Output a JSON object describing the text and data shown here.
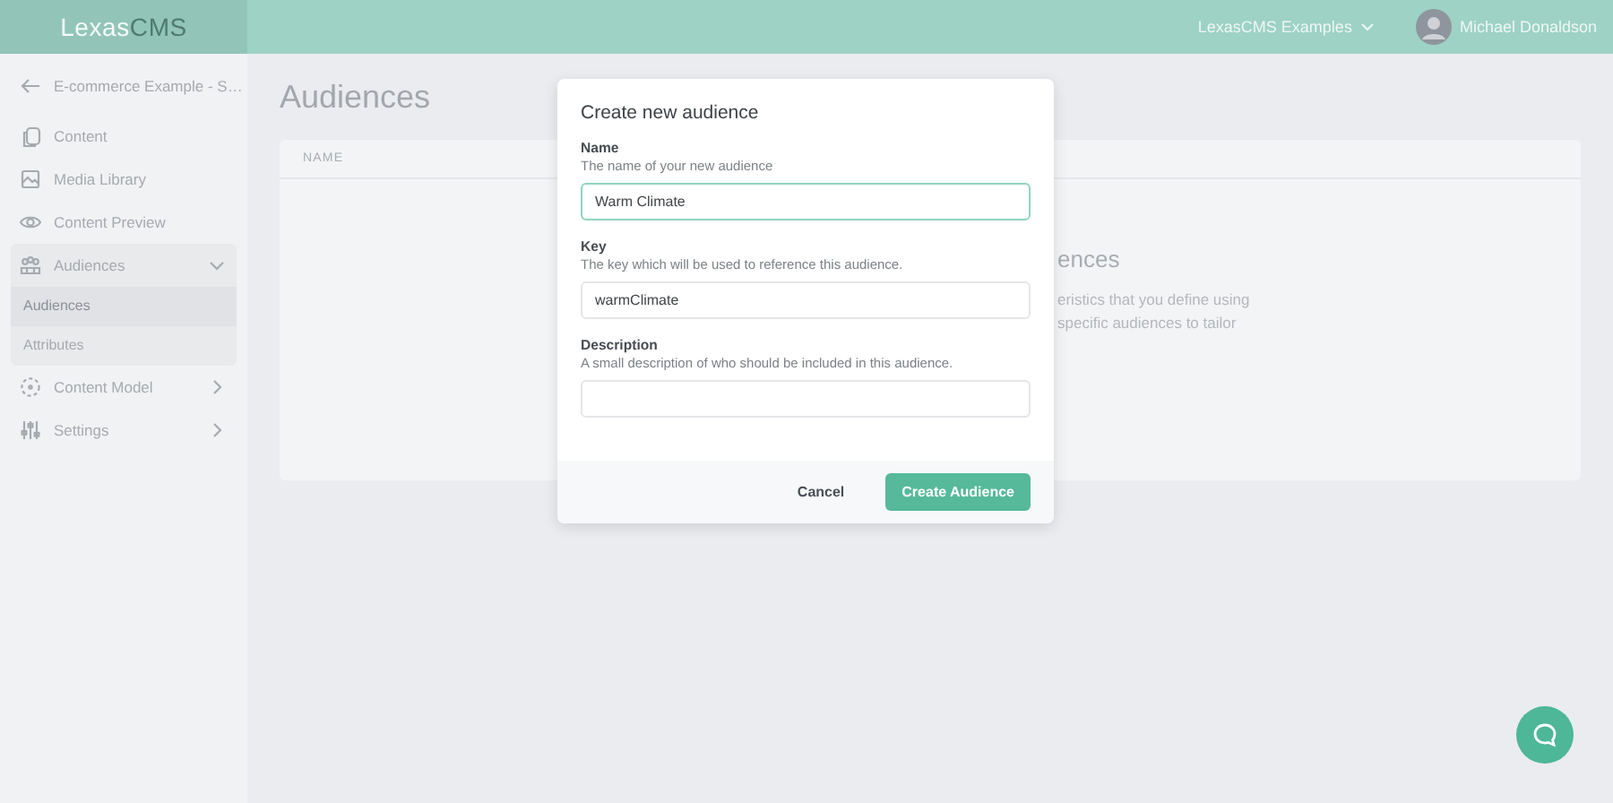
{
  "header": {
    "logo": [
      "Lexas",
      "CMS"
    ],
    "workspace": "LexasCMS Examples",
    "user": "Michael Donaldson"
  },
  "sidebar": {
    "back": "E-commerce Example - S…",
    "items": [
      {
        "kind": "link",
        "label": "Content"
      },
      {
        "kind": "link",
        "label": "Media Library"
      },
      {
        "kind": "link",
        "label": "Content Preview"
      },
      {
        "kind": "group",
        "label": "Audiences",
        "expanded": true,
        "children": [
          {
            "label": "Audiences",
            "selected": true
          },
          {
            "label": "Attributes",
            "selected": false
          }
        ]
      },
      {
        "kind": "group",
        "label": "Content Model",
        "expanded": false
      },
      {
        "kind": "group",
        "label": "Settings",
        "expanded": false
      }
    ]
  },
  "page": {
    "title": "Audiences",
    "table": {
      "columns": [
        "NAME"
      ]
    },
    "empty_state": {
      "title": "ences",
      "lines": [
        "eristics that you define using",
        "specific audiences to tailor"
      ]
    }
  },
  "modal": {
    "title": "Create new audience",
    "fields": [
      {
        "label": "Name",
        "hint": "The name of your new audience",
        "value": "Warm Climate",
        "focused": true
      },
      {
        "label": "Key",
        "hint": "The key which will be used to reference this audience.",
        "value": "warmClimate",
        "focused": false
      },
      {
        "label": "Description",
        "hint": "A small description of who should be included in this audience.",
        "focused": false
      }
    ],
    "buttons": [
      {
        "kind": "secondary",
        "label": "Cancel"
      },
      {
        "kind": "primary",
        "label": "Create Audience"
      }
    ]
  }
}
